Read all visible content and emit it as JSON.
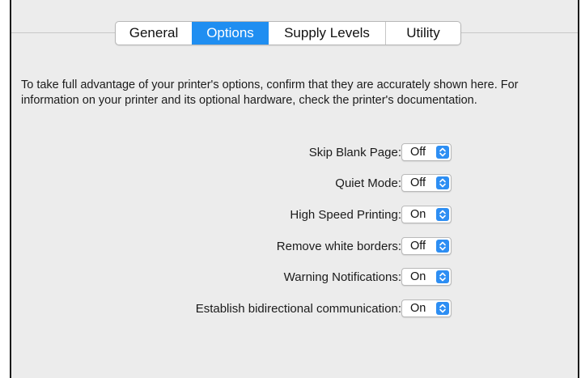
{
  "tabs": [
    {
      "label": "General",
      "active": false
    },
    {
      "label": "Options",
      "active": true
    },
    {
      "label": "Supply Levels",
      "active": false
    },
    {
      "label": "Utility",
      "active": false
    }
  ],
  "intro_text": "To take full advantage of your printer's options, confirm that they are accurately shown here. For information on your printer and its optional hardware, check the printer's documentation.",
  "options": [
    {
      "label": "Skip Blank Page:",
      "value": "Off"
    },
    {
      "label": "Quiet Mode:",
      "value": "Off"
    },
    {
      "label": "High Speed Printing:",
      "value": "On"
    },
    {
      "label": "Remove white borders:",
      "value": "Off"
    },
    {
      "label": "Warning Notifications:",
      "value": "On"
    },
    {
      "label": "Establish bidirectional communication:",
      "value": "On"
    }
  ],
  "colors": {
    "accent": "#1f8ef1",
    "panel_background": "#ececec"
  },
  "icons": {
    "popup_arrows": "up-down-chevrons-icon"
  }
}
